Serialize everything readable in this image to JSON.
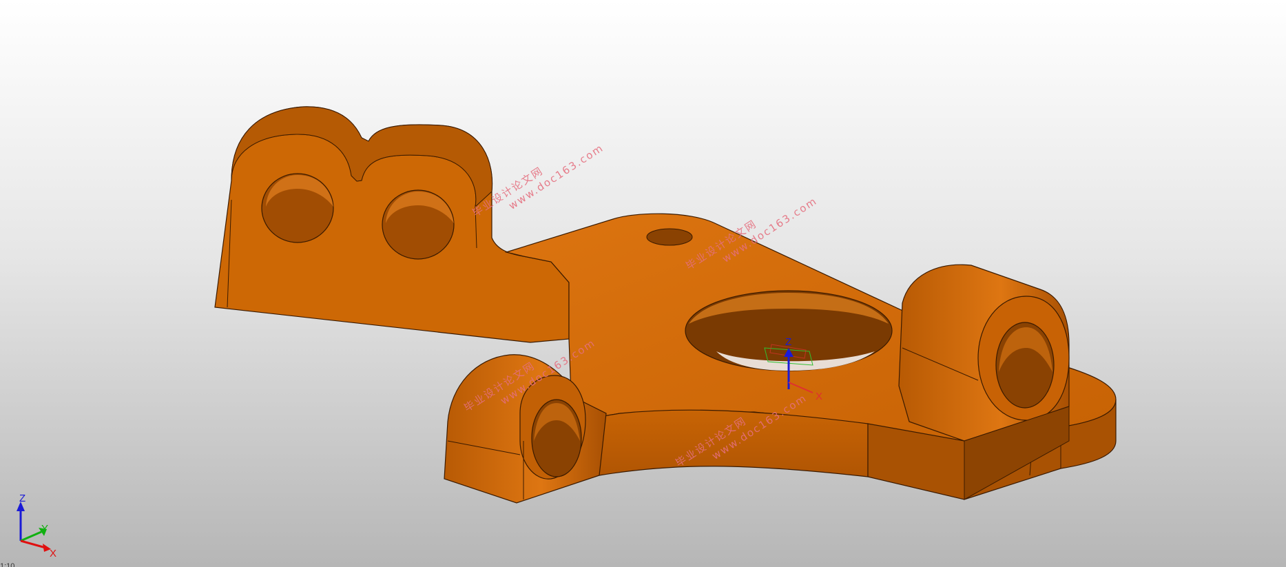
{
  "viewport": {
    "background_top": "#ffffff",
    "background_bottom": "#b6b6b6"
  },
  "model": {
    "color": "#d16a05",
    "shade_color": "#9a4b03",
    "edge_color": "#3a1a00"
  },
  "watermarks": [
    {
      "cn": "毕业设计论文网",
      "url": "www.doc163.com"
    },
    {
      "cn": "毕业设计论文网",
      "url": "www.doc163.com"
    },
    {
      "cn": "毕业设计论文网",
      "url": "www.doc163.com"
    },
    {
      "cn": "毕业设计论文网",
      "url": "www.doc163.com"
    }
  ],
  "triad": {
    "z_label": "Z",
    "y_label": "Y",
    "x_label": "X",
    "z_color": "#1a1ad6",
    "y_color": "#10b010",
    "x_color": "#e01010"
  },
  "origin_marker": {
    "z_label": "Z",
    "x_label": "X"
  },
  "corner_text": "1:10"
}
